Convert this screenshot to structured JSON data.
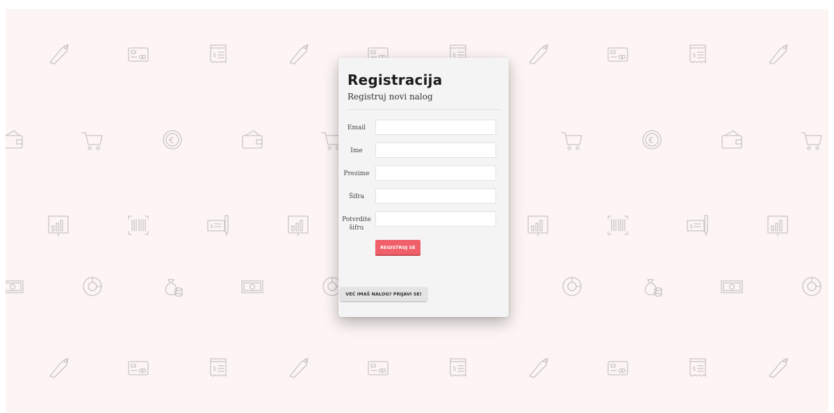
{
  "background": {
    "color": "#fcf5f3",
    "icon_color": "#c9c4c2",
    "rows": [
      [
        "tag-icon",
        "credit-card-icon",
        "receipt-icon",
        "tag-icon",
        "credit-card-icon",
        "receipt-icon",
        "tag-icon",
        "credit-card-icon",
        "receipt-icon",
        "tag-icon"
      ],
      [
        "wallet-icon",
        "cart-icon",
        "euro-coin-icon",
        "wallet-icon",
        "cart-icon",
        "euro-coin-icon",
        "wallet-icon",
        "cart-icon",
        "euro-coin-icon",
        "wallet-icon",
        "cart-icon"
      ],
      [
        "presentation-chart-icon",
        "barcode-icon",
        "cheque-icon",
        "presentation-chart-icon",
        "barcode-icon",
        "cheque-icon",
        "presentation-chart-icon",
        "barcode-icon",
        "cheque-icon",
        "presentation-chart-icon"
      ],
      [
        "banknote-icon",
        "donut-chart-icon",
        "money-bag-icon",
        "banknote-icon",
        "donut-chart-icon",
        "money-bag-icon",
        "banknote-icon",
        "donut-chart-icon",
        "money-bag-icon",
        "banknote-icon",
        "donut-chart-icon"
      ],
      [
        "tag-icon",
        "credit-card-icon",
        "receipt-icon",
        "tag-icon",
        "credit-card-icon",
        "receipt-icon",
        "tag-icon",
        "credit-card-icon",
        "receipt-icon",
        "tag-icon"
      ]
    ]
  },
  "card": {
    "title": "Registracija",
    "subtitle": "Registruj novi nalog",
    "fields": [
      {
        "label": "Email",
        "value": "",
        "type": "email"
      },
      {
        "label": "Ime",
        "value": "",
        "type": "text"
      },
      {
        "label": "Prezime",
        "value": "",
        "type": "text"
      },
      {
        "label": "Šifra",
        "value": "",
        "type": "password"
      },
      {
        "label": "Potvrdite šifru",
        "value": "",
        "type": "password"
      }
    ],
    "register_label": "REGISTRUJ SE",
    "login_label": "VEĆ IMAŠ NALOG? PRIJAVI SE!",
    "accent": "#f0606a"
  }
}
